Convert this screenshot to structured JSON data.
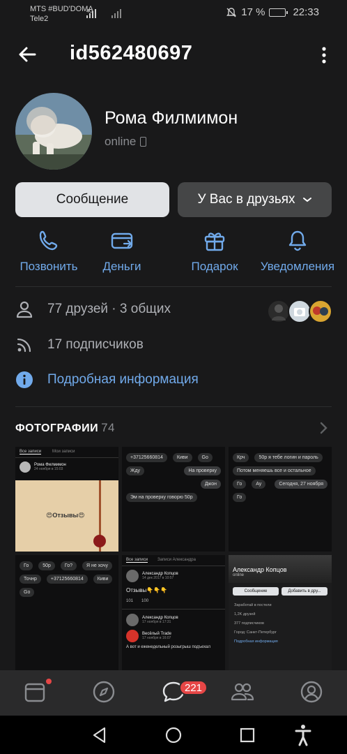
{
  "status_bar": {
    "carrier1": "MTS #BUD'DOMA",
    "carrier2": "Tele2",
    "network": "4G",
    "battery": "17 %",
    "time": "22:33"
  },
  "header": {
    "title": "id562480697",
    "back_icon": "arrow-left-icon",
    "more_icon": "more-vertical-icon"
  },
  "profile": {
    "name": "Рома Филмимон",
    "status": "online",
    "message_button": "Сообщение",
    "friends_button": "У Вас в друзьях"
  },
  "actions": [
    {
      "label": "Позвонить",
      "icon": "phone-icon"
    },
    {
      "label": "Деньги",
      "icon": "money-transfer-icon"
    },
    {
      "label": "Подарок",
      "icon": "gift-icon"
    },
    {
      "label": "Уведомления",
      "icon": "bell-icon"
    }
  ],
  "info": {
    "friends": "77 друзей · 3 общих",
    "followers": "17 подписчиков",
    "details": "Подробная информация"
  },
  "photos": {
    "title": "ФОТОГРАФИИ",
    "count": "74",
    "thumb1": {
      "tab1": "Все записи",
      "tab2": "Мои записи",
      "author": "Рома Филмимон",
      "date": "24 ноября в 15:03",
      "text": "😍Отзывы😍"
    },
    "thumb2": {
      "msgs": [
        "+37125660814",
        "Киви",
        "Go",
        "Жду",
        "На проверку",
        "Джон",
        "Эм на проверку говорю 50р"
      ]
    },
    "thumb3": {
      "msgs": [
        "Крч",
        "50р я тебе логин и пароль",
        "Потом меняешь все и остальное",
        "Сегодня, 27 ноября",
        "Го",
        "Ау",
        "Го"
      ]
    },
    "thumb4": {
      "msgs": [
        "Го",
        "50р",
        "Го?",
        "Я не хочу",
        "Точнр",
        "+37125660814",
        "Киви",
        "Go"
      ]
    },
    "thumb5": {
      "tab1": "Все записи",
      "tab2": "Записи Александра",
      "author": "Александр Копцов",
      "date": "14 дек 2017 в 10:57",
      "text": "Отзывы👇👇👇",
      "likes": "101",
      "comments": "100",
      "author2": "Александр Копцов",
      "date2": "17 ноября в 17:31",
      "group": "Весёлый Trade",
      "group_date": "17 ноября в 16:07",
      "post": "А вот и еженедельный розыгрыш подъехал"
    },
    "thumb6": {
      "name": "Александр Копцов",
      "status": "online",
      "btn1": "Сообщение",
      "btn2": "Добавить в дру...",
      "work": "Заработай в постели",
      "friends": "1,2K друзей",
      "followers": "377 подписчиков",
      "city": "Город: Санкт-Петербург",
      "details": "Подробная информация"
    }
  },
  "bottom_nav": {
    "badge": "221"
  }
}
